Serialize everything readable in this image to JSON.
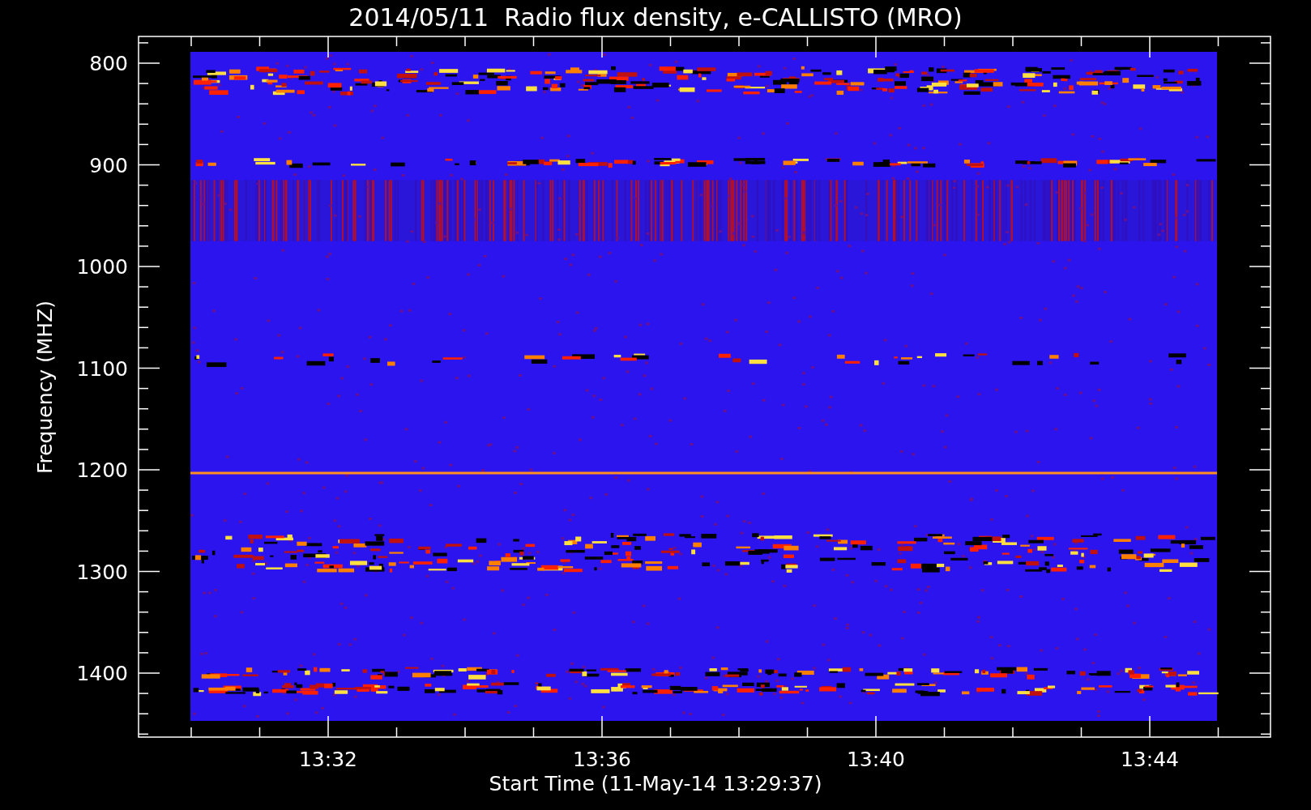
{
  "title": "2014/05/11  Radio flux density, e-CALLISTO (MRO)",
  "y_axis": {
    "label": "Frequency (MHZ)",
    "ticks": [
      "800",
      "900",
      "1000",
      "1100",
      "1200",
      "1300",
      "1400"
    ]
  },
  "x_axis": {
    "label": "Start Time (11-May-14 13:29:37)",
    "ticks": [
      "13:32",
      "13:36",
      "13:40",
      "13:44"
    ]
  }
}
